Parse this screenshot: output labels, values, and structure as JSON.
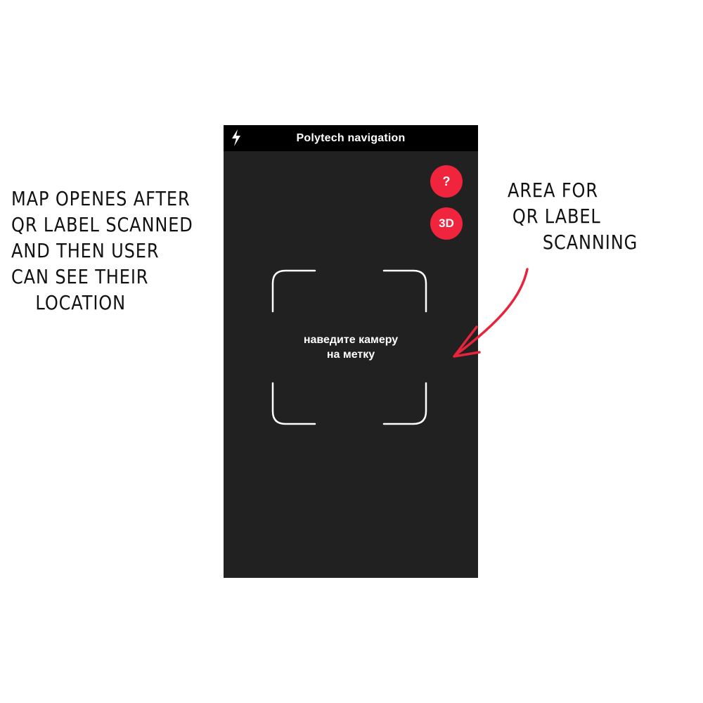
{
  "app": {
    "title": "Polytech navigation",
    "flash_icon": "lightning-icon"
  },
  "buttons": {
    "help_label": "?",
    "three_d_label": "3D"
  },
  "scanner": {
    "hint": "наведите камеру\nна метку"
  },
  "annotations": {
    "left_lines": [
      "MAP OPENES AFTER",
      "QR LABEL SCANNED",
      "AND THEN USER",
      "CAN SEE THEIR",
      "LOCATION"
    ],
    "right_lines": [
      "AREA FOR",
      "QR LABEL",
      "SCANNING"
    ]
  },
  "colors": {
    "screen_bg": "#212121",
    "topbar_bg": "#000000",
    "accent": "#f0243c",
    "arrow": "#e8243c"
  }
}
